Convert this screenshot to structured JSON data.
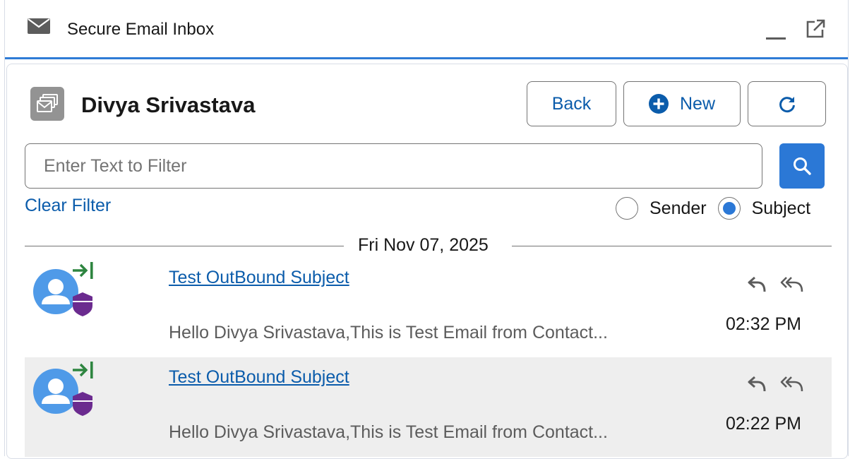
{
  "titlebar": {
    "title": "Secure Email Inbox",
    "icons": [
      "mail-icon",
      "minimize-icon",
      "popout-icon"
    ]
  },
  "record": {
    "name": "Divya Srivastava",
    "icon": "email-stack-icon"
  },
  "toolbar": {
    "back_label": "Back",
    "new_label": "New",
    "refresh_icon": "refresh-icon"
  },
  "filter": {
    "placeholder": "Enter Text to Filter",
    "value": "",
    "clear_label": "Clear Filter",
    "options": [
      {
        "label": "Sender",
        "selected": false
      },
      {
        "label": "Subject",
        "selected": true
      }
    ]
  },
  "date_group": "Fri Nov 07, 2025",
  "emails": [
    {
      "subject": "Test OutBound Subject",
      "preview": "Hello Divya Srivastava,This is Test Email from Contact...",
      "time": "02:32 PM",
      "direction": "outbound",
      "highlighted": false
    },
    {
      "subject": "Test OutBound Subject",
      "preview": "Hello Divya Srivastava,This is Test Email from Contact...",
      "time": "02:22 PM",
      "direction": "outbound",
      "highlighted": true
    }
  ],
  "colors": {
    "accent": "#2b78d6",
    "link": "#0b5cab",
    "outbound": "#2e8540",
    "shield": "#6b2b8f",
    "avatar": "#4f9ae8"
  }
}
